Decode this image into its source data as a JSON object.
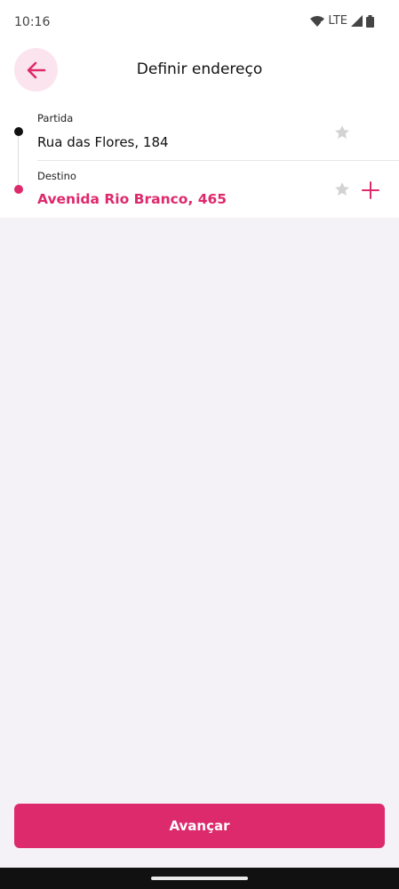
{
  "status_bar": {
    "time": "10:16",
    "network": "LTE"
  },
  "header": {
    "title": "Definir endereço",
    "back_icon": "arrow-left-icon"
  },
  "route": {
    "origin": {
      "label": "Partida",
      "value": "Rua das Flores, 184"
    },
    "destination": {
      "label": "Destino",
      "value": "Avenida Rio Branco, 465"
    }
  },
  "actions": {
    "next_label": "Avançar"
  },
  "colors": {
    "accent": "#dd2a6c",
    "accent_light": "#fbe4ee",
    "background": "#f4f2f6"
  }
}
